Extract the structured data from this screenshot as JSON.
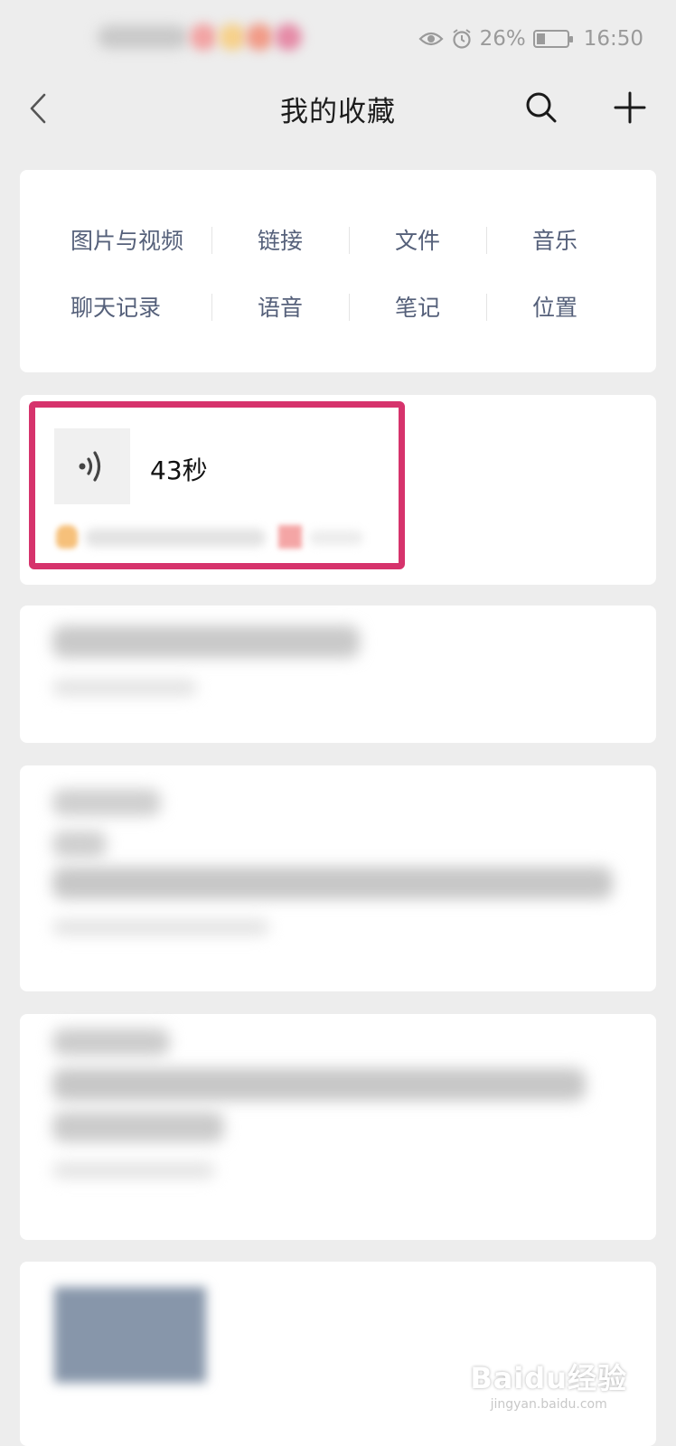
{
  "status_bar": {
    "battery": "26%",
    "time": "16:50"
  },
  "header": {
    "title": "我的收藏"
  },
  "categories": {
    "row1": [
      "图片与视频",
      "链接",
      "文件",
      "音乐"
    ],
    "row2": [
      "聊天记录",
      "语音",
      "笔记",
      "位置"
    ]
  },
  "favorites": {
    "voice_item": {
      "duration": "43秒"
    }
  },
  "colors": {
    "background": "#ededed",
    "card": "#ffffff",
    "category_text": "#55607a",
    "highlight": "#d6336c"
  },
  "icons": {
    "back": "chevron-left-icon",
    "search": "search-icon",
    "add": "plus-icon",
    "voice": "voice-wave-icon"
  },
  "watermark": {
    "main": "Baidu经验",
    "sub": "jingyan.baidu.com"
  }
}
